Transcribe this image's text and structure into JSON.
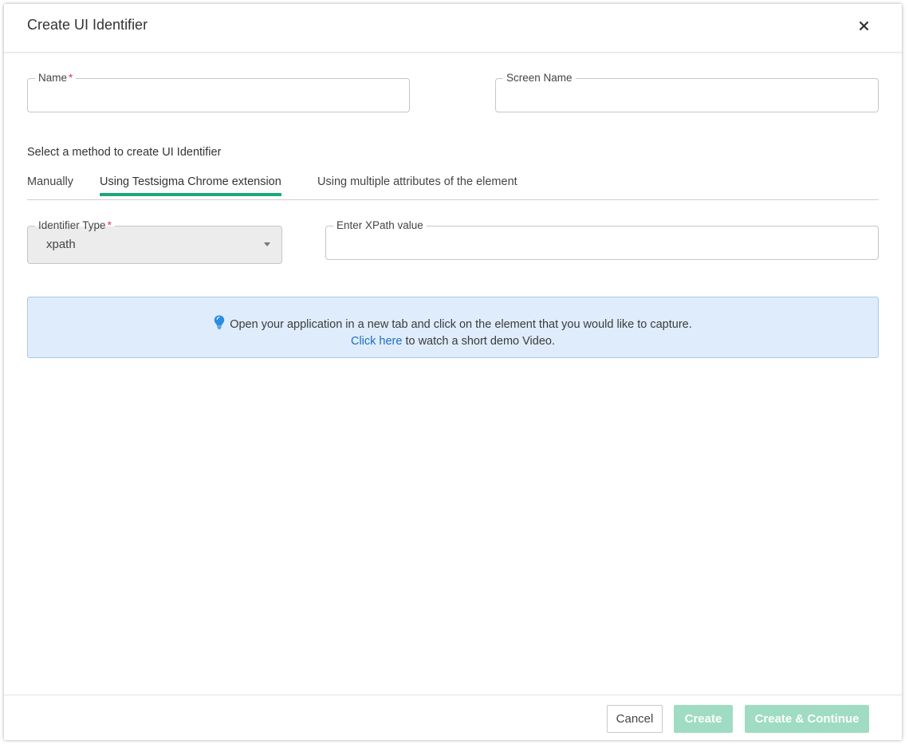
{
  "dialog": {
    "title": "Create UI Identifier"
  },
  "form": {
    "name_label": "Name",
    "name_required_mark": "*",
    "name_value": "",
    "screen_name_label": "Screen Name",
    "screen_name_value": ""
  },
  "method": {
    "label": "Select a method to create UI Identifier",
    "tabs": [
      {
        "label": "Manually",
        "active": false
      },
      {
        "label": "Using Testsigma Chrome extension",
        "active": true
      },
      {
        "label": "Using multiple attributes of the element",
        "active": false
      }
    ]
  },
  "identifier": {
    "type_label": "Identifier Type",
    "type_required_mark": "*",
    "type_value": "xpath",
    "xpath_label": "Enter XPath value",
    "xpath_value": ""
  },
  "info": {
    "icon": "lightbulb-icon",
    "line1": "Open your application in a new tab and click on the element that you would like to capture.",
    "link_text": "Click here",
    "line2_rest": " to watch a short demo Video."
  },
  "footer": {
    "cancel_label": "Cancel",
    "create_label": "Create",
    "create_continue_label": "Create & Continue"
  },
  "colors": {
    "accent_tab": "#1aa877",
    "disabled_button": "#9fdcc3",
    "info_bg": "#dfecfb",
    "link": "#1a6fc4",
    "required": "#e0344a"
  }
}
